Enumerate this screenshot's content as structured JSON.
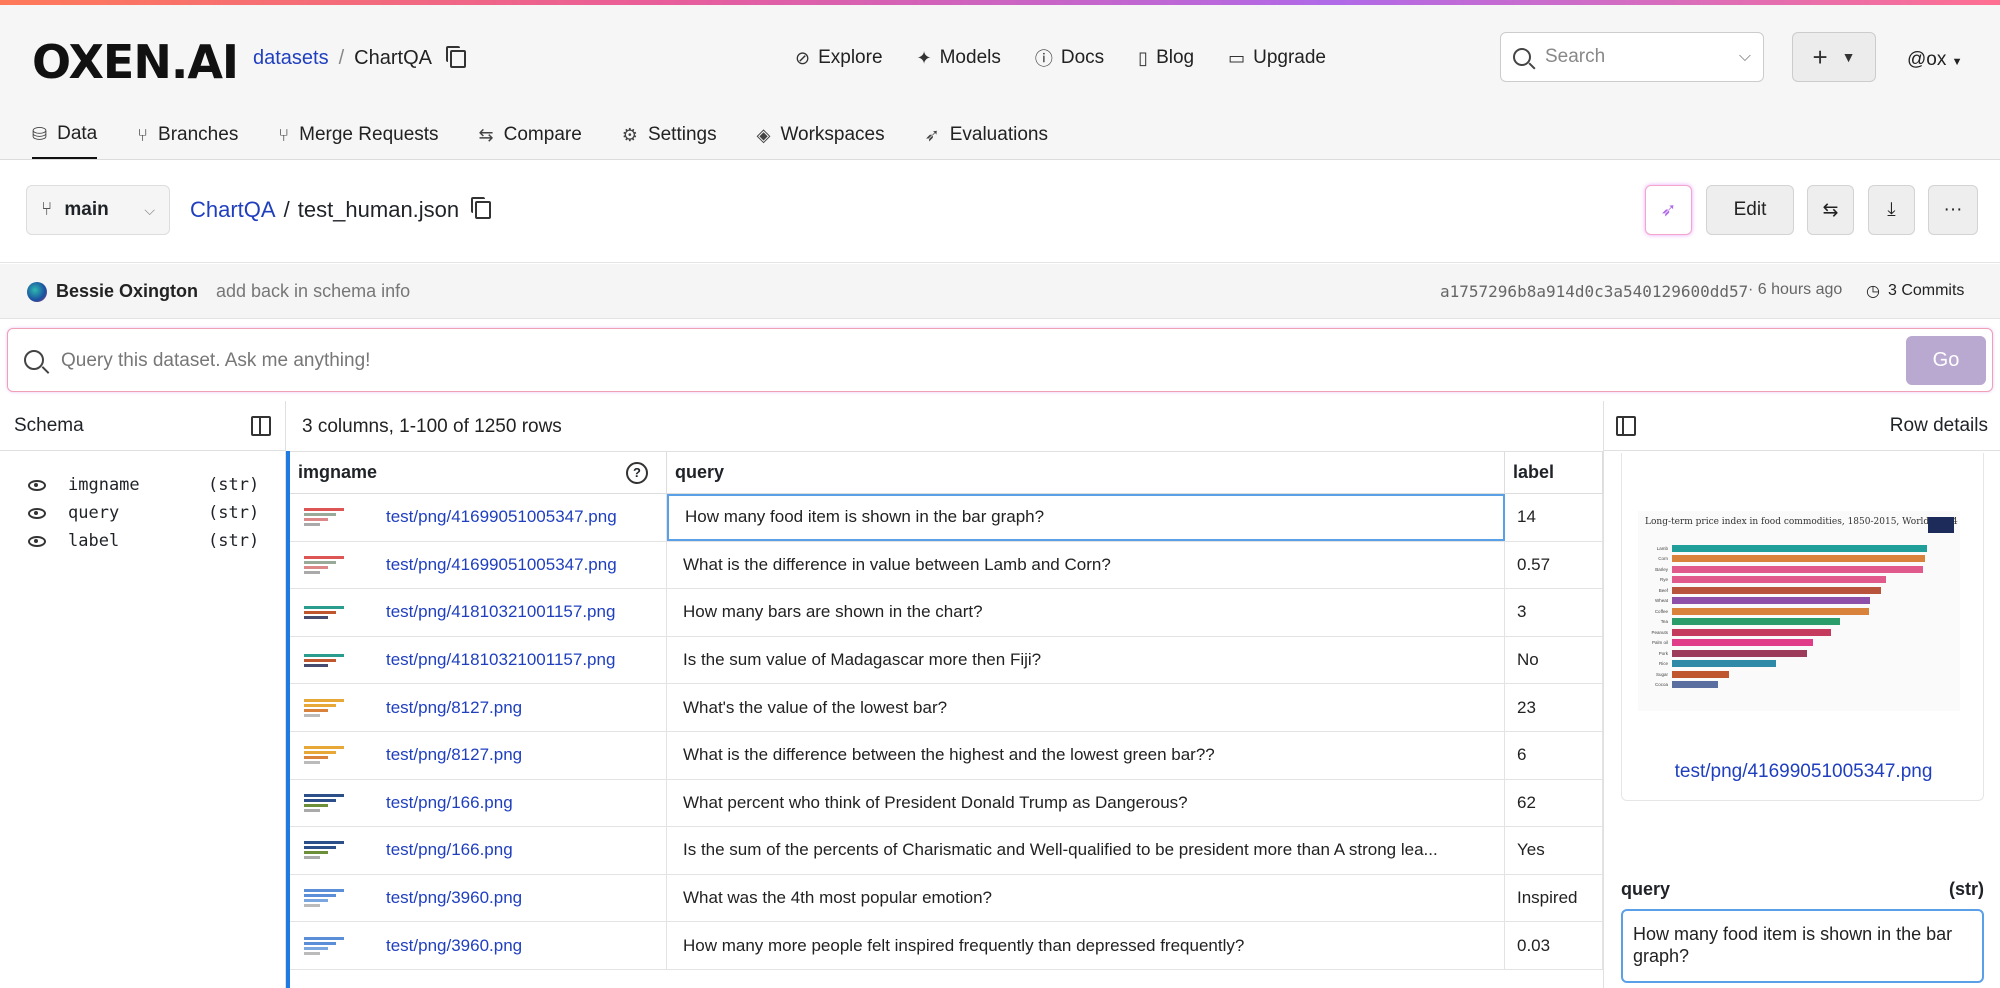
{
  "app": {
    "logo": "OXEN.AI"
  },
  "breadcrumb": {
    "datasets": "datasets",
    "sep": "/",
    "repo": "ChartQA"
  },
  "topnav": [
    {
      "label": "Explore",
      "icon": "compass-icon"
    },
    {
      "label": "Models",
      "icon": "sparkle-icon"
    },
    {
      "label": "Docs",
      "icon": "info-icon"
    },
    {
      "label": "Blog",
      "icon": "book-icon"
    },
    {
      "label": "Upgrade",
      "icon": "card-icon"
    }
  ],
  "search": {
    "placeholder": "Search"
  },
  "user": {
    "handle": "@ox"
  },
  "tabs": [
    {
      "label": "Data",
      "icon": "database-icon",
      "active": true
    },
    {
      "label": "Branches",
      "icon": "branch-icon"
    },
    {
      "label": "Merge Requests",
      "icon": "merge-icon"
    },
    {
      "label": "Compare",
      "icon": "compare-icon"
    },
    {
      "label": "Settings",
      "icon": "gear-icon"
    },
    {
      "label": "Workspaces",
      "icon": "layers-icon"
    },
    {
      "label": "Evaluations",
      "icon": "rocket-icon"
    }
  ],
  "file": {
    "branch": "main",
    "repo": "ChartQA",
    "sep": "/",
    "name": "test_human.json",
    "edit_label": "Edit"
  },
  "commit": {
    "author": "Bessie Oxington",
    "message": "add back in schema info",
    "hash": "a1757296b8a914d0c3a540129600dd57",
    "time": "· 6 hours ago",
    "commits": "3 Commits"
  },
  "query": {
    "placeholder": "Query this dataset. Ask me anything!",
    "go": "Go"
  },
  "schema": {
    "title": "Schema",
    "fields": [
      {
        "name": "imgname",
        "type": "(str)"
      },
      {
        "name": "query",
        "type": "(str)"
      },
      {
        "name": "label",
        "type": "(str)"
      }
    ]
  },
  "grid": {
    "info": "3 columns, 1-100 of 1250 rows",
    "headers": [
      "imgname",
      "query",
      "label"
    ],
    "rows": [
      {
        "img": "test/png/41699051005347.png",
        "query": "How many food item is shown in the bar graph?",
        "label": "14"
      },
      {
        "img": "test/png/41699051005347.png",
        "query": "What is the difference in value between Lamb and Corn?",
        "label": "0.57"
      },
      {
        "img": "test/png/41810321001157.png",
        "query": "How many bars are shown in the chart?",
        "label": "3"
      },
      {
        "img": "test/png/41810321001157.png",
        "query": "Is the sum value of Madagascar more then Fiji?",
        "label": "No"
      },
      {
        "img": "test/png/8127.png",
        "query": "What's the value of the lowest bar?",
        "label": "23"
      },
      {
        "img": "test/png/8127.png",
        "query": "What is the difference between the highest and the lowest green bar??",
        "label": "6"
      },
      {
        "img": "test/png/166.png",
        "query": "What percent who think of President Donald Trump as Dangerous?",
        "label": "62"
      },
      {
        "img": "test/png/166.png",
        "query": "Is the sum of the percents of Charismatic and Well-qualified to be president more than A strong lea...",
        "label": "Yes"
      },
      {
        "img": "test/png/3960.png",
        "query": "What was the 4th most popular emotion?",
        "label": "Inspired"
      },
      {
        "img": "test/png/3960.png",
        "query": "How many more people felt inspired frequently than depressed frequently?",
        "label": "0.03"
      }
    ]
  },
  "details": {
    "title": "Row details",
    "image_name": "test/png/41699051005347.png",
    "query_label": "query",
    "query_type": "(str)",
    "query_value": "How many food item is shown in the bar graph?",
    "thumb_title": "Long-term price index in food commodities, 1850-2015, World, 1934",
    "thumb_items": [
      {
        "name": "Lamb",
        "value": 103.7,
        "color": "#1f9e9a"
      },
      {
        "name": "Corn",
        "value": 103.13,
        "color": "#d9823b"
      },
      {
        "name": "Barley",
        "value": 102.46,
        "color": "#e05a8c"
      },
      {
        "name": "Rye",
        "value": 87.37,
        "color": "#e05a8c"
      },
      {
        "name": "Beef",
        "value": 85.27,
        "color": "#b8543c"
      },
      {
        "name": "Wheat",
        "value": 80.73,
        "color": "#8e4fa8"
      },
      {
        "name": "Coffee",
        "value": 80.2,
        "color": "#d9823b"
      },
      {
        "name": "Tea",
        "value": 68.49,
        "color": "#2a9d6a"
      },
      {
        "name": "Peanuts",
        "value": 64.71,
        "color": "#c43b5e"
      },
      {
        "name": "Palm oil",
        "value": 57.6,
        "color": "#e03c8a"
      },
      {
        "name": "Pork",
        "value": 55.16,
        "color": "#9c3b5a"
      },
      {
        "name": "Rice",
        "value": 42.46,
        "color": "#2f8aa8"
      },
      {
        "name": "Sugar",
        "value": 23.36,
        "color": "#c0562e"
      },
      {
        "name": "Cocoa",
        "value": 18.81,
        "color": "#5a6fa0"
      }
    ]
  }
}
